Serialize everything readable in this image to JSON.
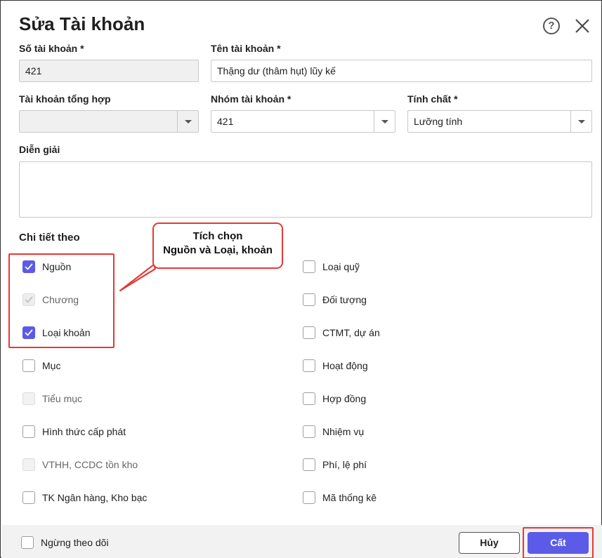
{
  "dialog": {
    "title": "Sửa Tài khoản",
    "help_icon": "help-icon",
    "close_icon": "close-icon"
  },
  "fields": {
    "account_number": {
      "label": "Số tài khoản *",
      "value": "421"
    },
    "account_name": {
      "label": "Tên tài khoản *",
      "value": "Thặng dư (thâm hụt) lũy kế"
    },
    "parent_account": {
      "label": "Tài khoản tổng hợp",
      "value": ""
    },
    "account_group": {
      "label": "Nhóm tài khoản *",
      "value": "421"
    },
    "nature": {
      "label": "Tính chất *",
      "value": "Lưỡng tính"
    },
    "description": {
      "label": "Diễn giải",
      "value": ""
    }
  },
  "details": {
    "title": "Chi tiết theo",
    "left": [
      {
        "label": "Nguồn",
        "state": "checked"
      },
      {
        "label": "Chương",
        "state": "checked-disabled"
      },
      {
        "label": "Loại khoản",
        "state": "checked"
      },
      {
        "label": "Mục",
        "state": "unchecked"
      },
      {
        "label": "Tiểu mục",
        "state": "disabled"
      },
      {
        "label": "Hình thức cấp phát",
        "state": "unchecked"
      },
      {
        "label": "VTHH, CCDC tồn kho",
        "state": "disabled"
      },
      {
        "label": "TK Ngân hàng, Kho bạc",
        "state": "unchecked"
      }
    ],
    "right": [
      {
        "label": "Loại quỹ",
        "state": "unchecked"
      },
      {
        "label": "Đối tượng",
        "state": "unchecked"
      },
      {
        "label": "CTMT, dự án",
        "state": "unchecked"
      },
      {
        "label": "Hoạt động",
        "state": "unchecked"
      },
      {
        "label": "Hợp đồng",
        "state": "unchecked"
      },
      {
        "label": "Nhiệm vụ",
        "state": "unchecked"
      },
      {
        "label": "Phí, lệ phí",
        "state": "unchecked"
      },
      {
        "label": "Mã thống kê",
        "state": "unchecked"
      }
    ]
  },
  "callout": {
    "line1": "Tích chọn",
    "line2": "Nguồn và Loại, khoản"
  },
  "footer": {
    "stop_tracking": {
      "label": "Ngừng theo dõi",
      "state": "unchecked"
    },
    "cancel_label": "Hủy",
    "save_label": "Cất"
  },
  "colors": {
    "accent": "#5b5be8",
    "annotation": "#e53935"
  }
}
